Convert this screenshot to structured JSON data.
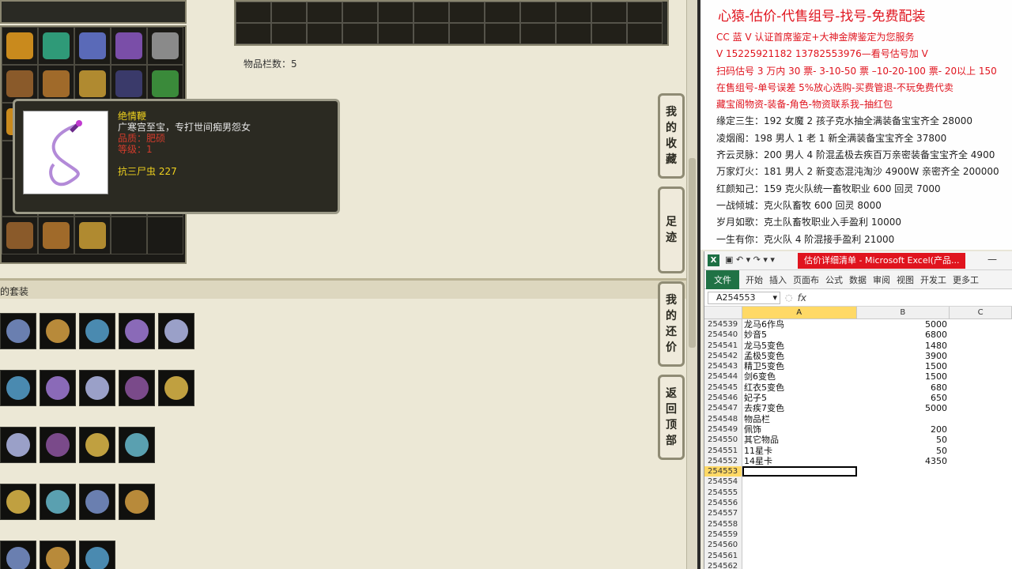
{
  "game": {
    "item_count_label": "物品栏数：5",
    "set_section_label": "的套装",
    "tooltip": {
      "name": "绝情鞭",
      "description": "广寒宫至宝，专打世间痴男怨女",
      "quality": "品质：肥硕",
      "level": "等级：1",
      "stat": "抗三尸虫 227"
    },
    "side_buttons": [
      {
        "label": "我的收藏",
        "chars": [
          "我",
          "的",
          "收",
          "藏"
        ]
      },
      {
        "label": "足迹",
        "chars": [
          "足",
          "迹"
        ]
      },
      {
        "label": "我的还价",
        "chars": [
          "我",
          "的",
          "还",
          "价"
        ]
      },
      {
        "label": "返回顶部",
        "chars": [
          "返",
          "回",
          "顶",
          "部"
        ]
      }
    ],
    "icon_colors": [
      "#c98a1d",
      "#2f9a78",
      "#5a6ab8",
      "#7a4ea8",
      "#8a8a8a",
      "#8a5a2a",
      "#a06a2a",
      "#b08a30",
      "#3a3a6a",
      "#3a8a3a"
    ]
  },
  "ad": {
    "title": "心猿-估价-代售组号-找号-免费配装",
    "lines": [
      {
        "text": "CC 蓝 V 认证首席鉴定+大神金牌鉴定为您服务",
        "color": "red"
      },
      {
        "text": "V 15225921182      13782553976—看号估号加 V",
        "color": "red"
      },
      {
        "text": "扫码估号 3 万内 30 票- 3-10-50 票  –10-20-100 票- 20以上 150",
        "color": "red"
      },
      {
        "text": "在售组号-单号误差 5%放心选购-买费管退-不玩免费代卖",
        "color": "red"
      },
      {
        "text": "藏宝阁物资-装备-角色-物资联系我–抽红包",
        "color": "red"
      },
      {
        "text": "缘定三生：192 女魔 2 孩子克水抽全满装备宝宝齐全 28000",
        "color": "black"
      },
      {
        "text": "凌烟阁：198 男人 1 老 1 新全满装备宝宝齐全 37800",
        "color": "black"
      },
      {
        "text": "齐云灵脉：200 男人 4 阶混孟极去疾百万亲密装备宝宝齐全 4900",
        "color": "black"
      },
      {
        "text": "万家灯火：181 男人 2 新变态混沌淘沙 4900W 亲密齐全 200000",
        "color": "black"
      },
      {
        "text": "红颜知己：159 克火队统一畜牧职业 600 回灵 7000",
        "color": "black"
      },
      {
        "text": "一战倾城：克火队畜牧 600 回灵 8000",
        "color": "black"
      },
      {
        "text": "岁月如歌：克土队畜牧职业入手盈利 10000",
        "color": "black"
      },
      {
        "text": "一生有你：克火队 4 阶混接手盈利 21000",
        "color": "black"
      }
    ]
  },
  "excel": {
    "window_title": "估价详细清单 - Microsoft Excel(产品...",
    "name_box": "A254553",
    "fx_label": "fx",
    "ribbon_tabs": [
      "文件",
      "开始",
      "插入",
      "页面布",
      "公式",
      "数据",
      "审阅",
      "视图",
      "开发工",
      "更多工"
    ],
    "columns": [
      "A",
      "B",
      "C"
    ],
    "rows": [
      {
        "n": "254539",
        "a": "龙马6作鸟",
        "b": "5000"
      },
      {
        "n": "254540",
        "a": "妙音5",
        "b": "6800"
      },
      {
        "n": "254541",
        "a": "龙马5变色",
        "b": "1480"
      },
      {
        "n": "254542",
        "a": "孟极5变色",
        "b": "3900"
      },
      {
        "n": "254543",
        "a": "精卫5变色",
        "b": "1500"
      },
      {
        "n": "254544",
        "a": "剑6变色",
        "b": "1500"
      },
      {
        "n": "254545",
        "a": "红衣5变色",
        "b": "680"
      },
      {
        "n": "254546",
        "a": "妃子5",
        "b": "650"
      },
      {
        "n": "254547",
        "a": "去疾7变色",
        "b": "5000"
      },
      {
        "n": "254548",
        "a": "物品栏",
        "b": ""
      },
      {
        "n": "254549",
        "a": "佩饰",
        "b": "200"
      },
      {
        "n": "254550",
        "a": "其它物品",
        "b": "50"
      },
      {
        "n": "254551",
        "a": "11星卡",
        "b": "50"
      },
      {
        "n": "254552",
        "a": "14星卡",
        "b": "4350"
      },
      {
        "n": "254553",
        "a": "",
        "b": ""
      },
      {
        "n": "254554",
        "a": "",
        "b": ""
      },
      {
        "n": "254555",
        "a": "",
        "b": ""
      },
      {
        "n": "254556",
        "a": "",
        "b": ""
      },
      {
        "n": "254557",
        "a": "",
        "b": ""
      },
      {
        "n": "254558",
        "a": "",
        "b": ""
      },
      {
        "n": "254559",
        "a": "",
        "b": ""
      },
      {
        "n": "254560",
        "a": "",
        "b": ""
      },
      {
        "n": "254561",
        "a": "",
        "b": ""
      },
      {
        "n": "254562",
        "a": "",
        "b": ""
      }
    ],
    "active_row": "254553"
  }
}
